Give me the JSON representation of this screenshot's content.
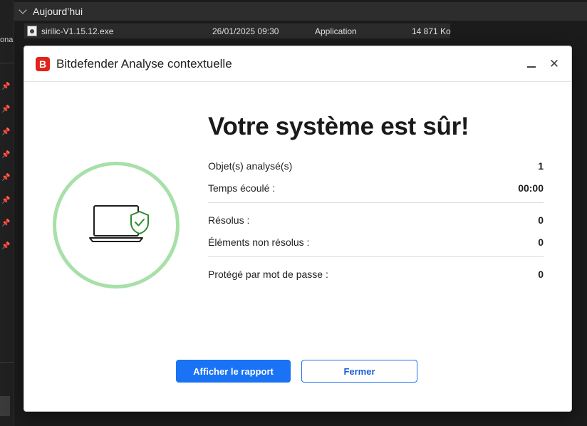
{
  "explorer": {
    "left_cut_text": "ona",
    "group_header": "Aujourd’hui",
    "file": {
      "name": "sirilic-V1.15.12.exe",
      "date": "26/01/2025 09:30",
      "type": "Application",
      "size": "14 871 Ko"
    }
  },
  "dialog": {
    "logo_letter": "B",
    "title": "Bitdefender Analyse contextuelle",
    "headline": "Votre système est sûr!",
    "stats": {
      "scanned": {
        "label": "Objet(s) analysé(s)",
        "value": "1"
      },
      "elapsed": {
        "label": "Temps écoulé :",
        "value": "00:00"
      },
      "resolved": {
        "label": "Résolus :",
        "value": "0"
      },
      "unresolved": {
        "label": "Éléments non résolus :",
        "value": "0"
      },
      "password": {
        "label": "Protégé par mot de passe :",
        "value": "0"
      }
    },
    "buttons": {
      "report": "Afficher le rapport",
      "close": "Fermer"
    },
    "colors": {
      "brand": "#e2231a",
      "primary": "#1a73f4",
      "ring": "#a7e0a8",
      "shield": "#2e8b2e"
    }
  }
}
